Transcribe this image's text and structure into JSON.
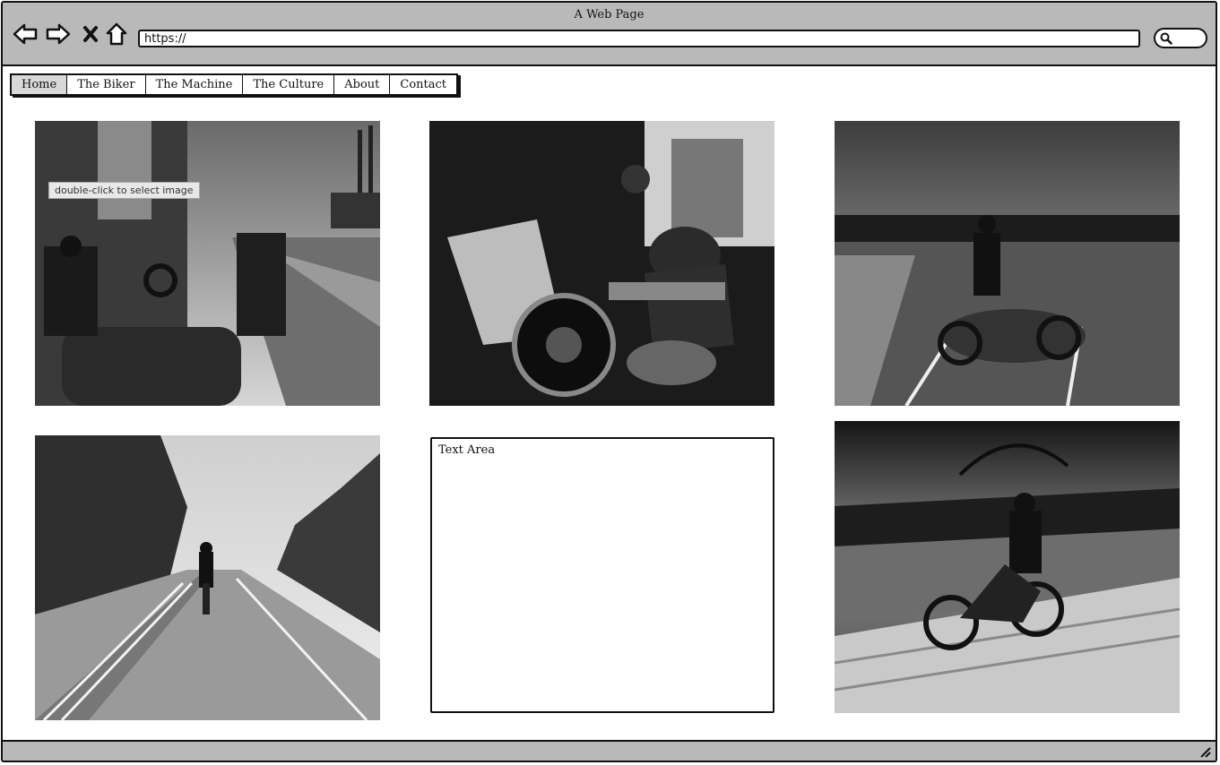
{
  "window": {
    "title": "A Web Page"
  },
  "browser": {
    "url": "https://",
    "back_icon": "back-arrow-icon",
    "forward_icon": "forward-arrow-icon",
    "stop_icon": "close-x-icon",
    "home_icon": "home-icon",
    "search_icon": "search-icon"
  },
  "menu": {
    "items": [
      {
        "label": "Home",
        "active": true
      },
      {
        "label": "The Biker",
        "active": false
      },
      {
        "label": "The Machine",
        "active": false
      },
      {
        "label": "The Culture",
        "active": false
      },
      {
        "label": "About",
        "active": false
      },
      {
        "label": "Contact",
        "active": false
      }
    ]
  },
  "content": {
    "tooltip": "double-click to select image",
    "text_area_label": "Text Area"
  },
  "colors": {
    "chrome": "#b9b9b9",
    "active_tab": "#d8d8d8",
    "border": "#111111"
  }
}
